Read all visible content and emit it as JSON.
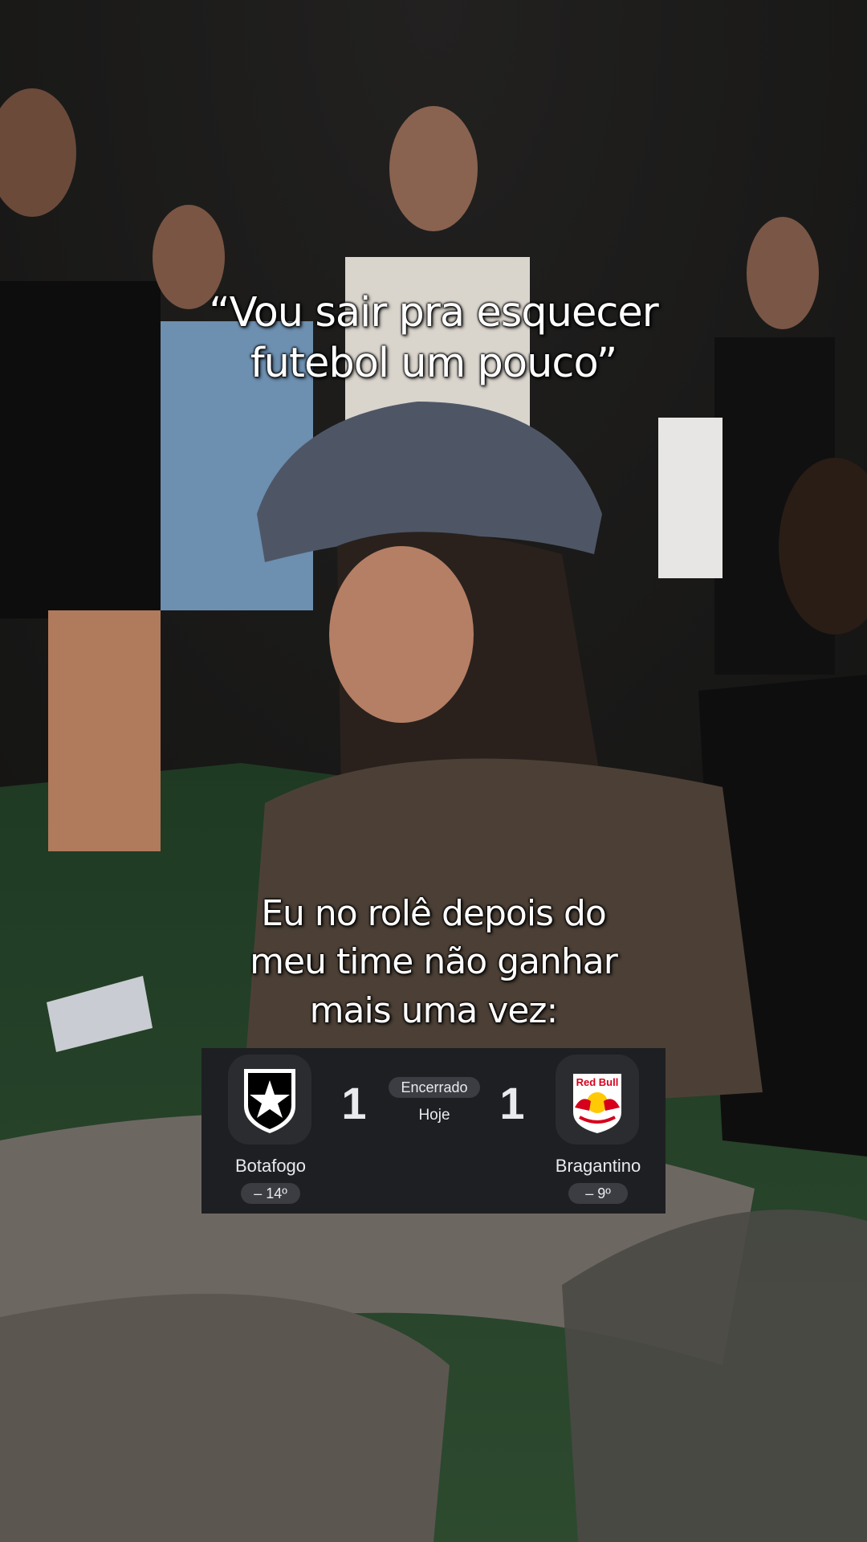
{
  "top_caption": {
    "line1": "“Vou sair pra esquecer",
    "line2": "futebol um pouco”"
  },
  "bottom_caption": {
    "line1": "Eu no rolê depois do",
    "line2": "meu time não ganhar",
    "line3": "mais uma vez:"
  },
  "scoreboard": {
    "status": "Encerrado",
    "date": "Hoje",
    "home": {
      "name": "Botafogo",
      "score": "1",
      "position": "– 14º",
      "crest_icon": "botafogo-star-crest"
    },
    "away": {
      "name": "Bragantino",
      "score": "1",
      "position": "– 9º",
      "crest_icon": "red-bull-bragantino-crest",
      "crest_text": "Red Bull"
    }
  },
  "colors": {
    "caption_text": "#ffffff",
    "scoreboard_bg": "#1e1f22",
    "badge_bg": "#3c3d42",
    "red_bull_red": "#d6001c",
    "red_bull_yellow": "#ffc906"
  }
}
